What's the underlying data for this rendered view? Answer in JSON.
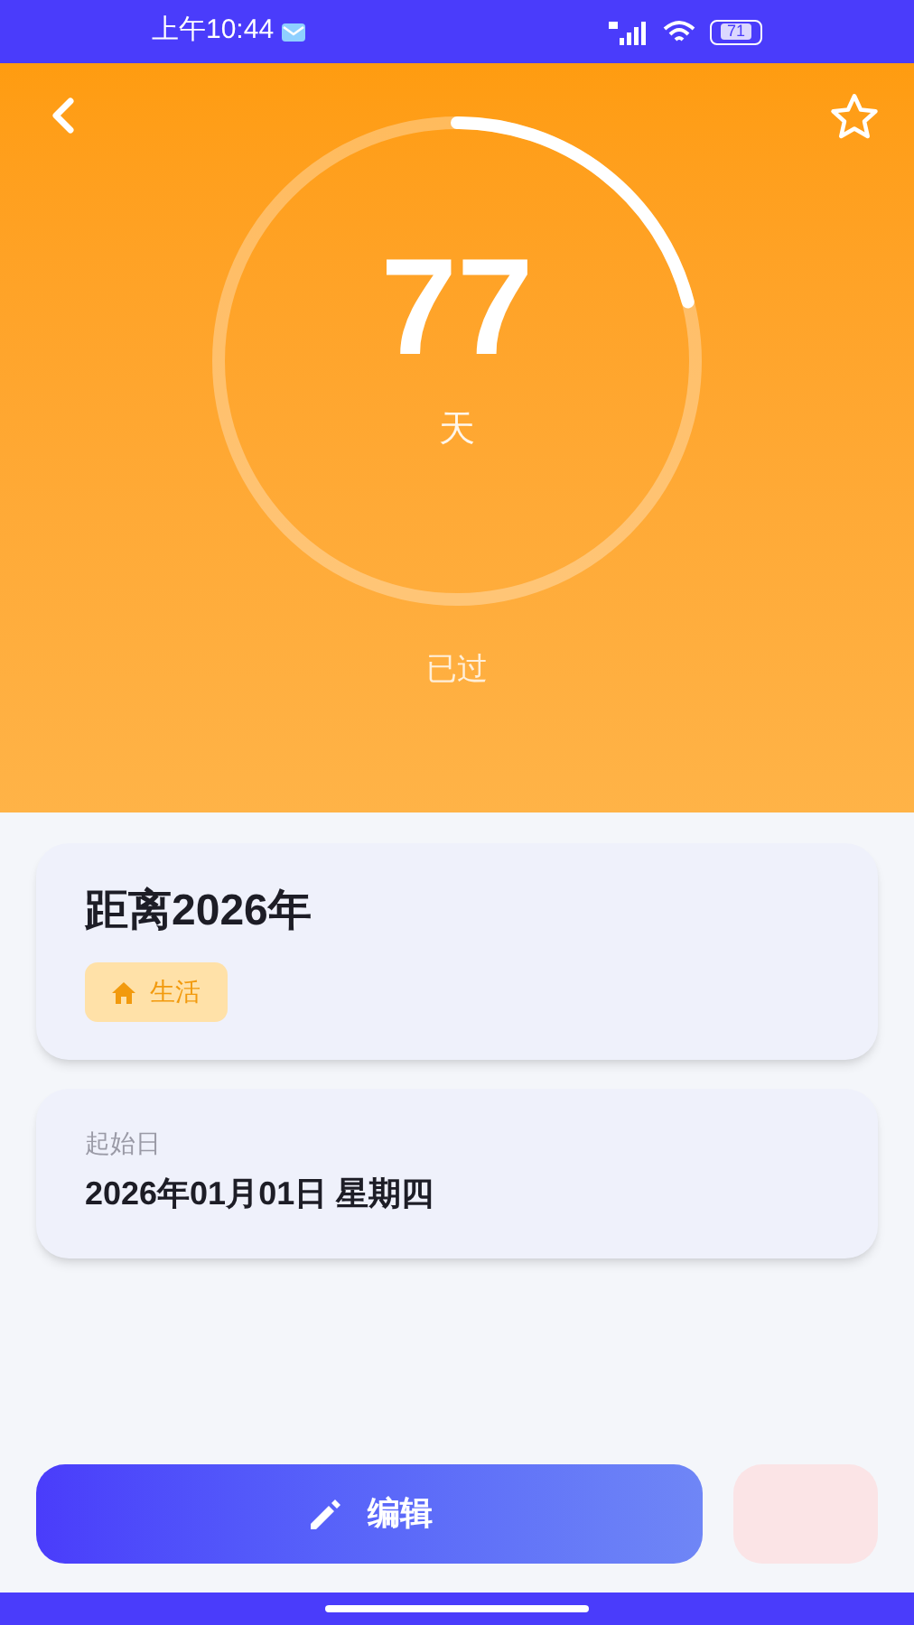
{
  "status_bar": {
    "time": "上午10:44",
    "battery": "71"
  },
  "countdown": {
    "level": 0.21,
    "number": "77",
    "unit": "天",
    "caption": "已过"
  },
  "event": {
    "title": "距离2026年",
    "tag": "生活"
  },
  "start_date": {
    "label": "起始日",
    "value": "2026年01月01日 星期四"
  },
  "actions": [
    {
      "kind": "primary",
      "label": "编辑"
    },
    {
      "kind": "secondary"
    }
  ]
}
